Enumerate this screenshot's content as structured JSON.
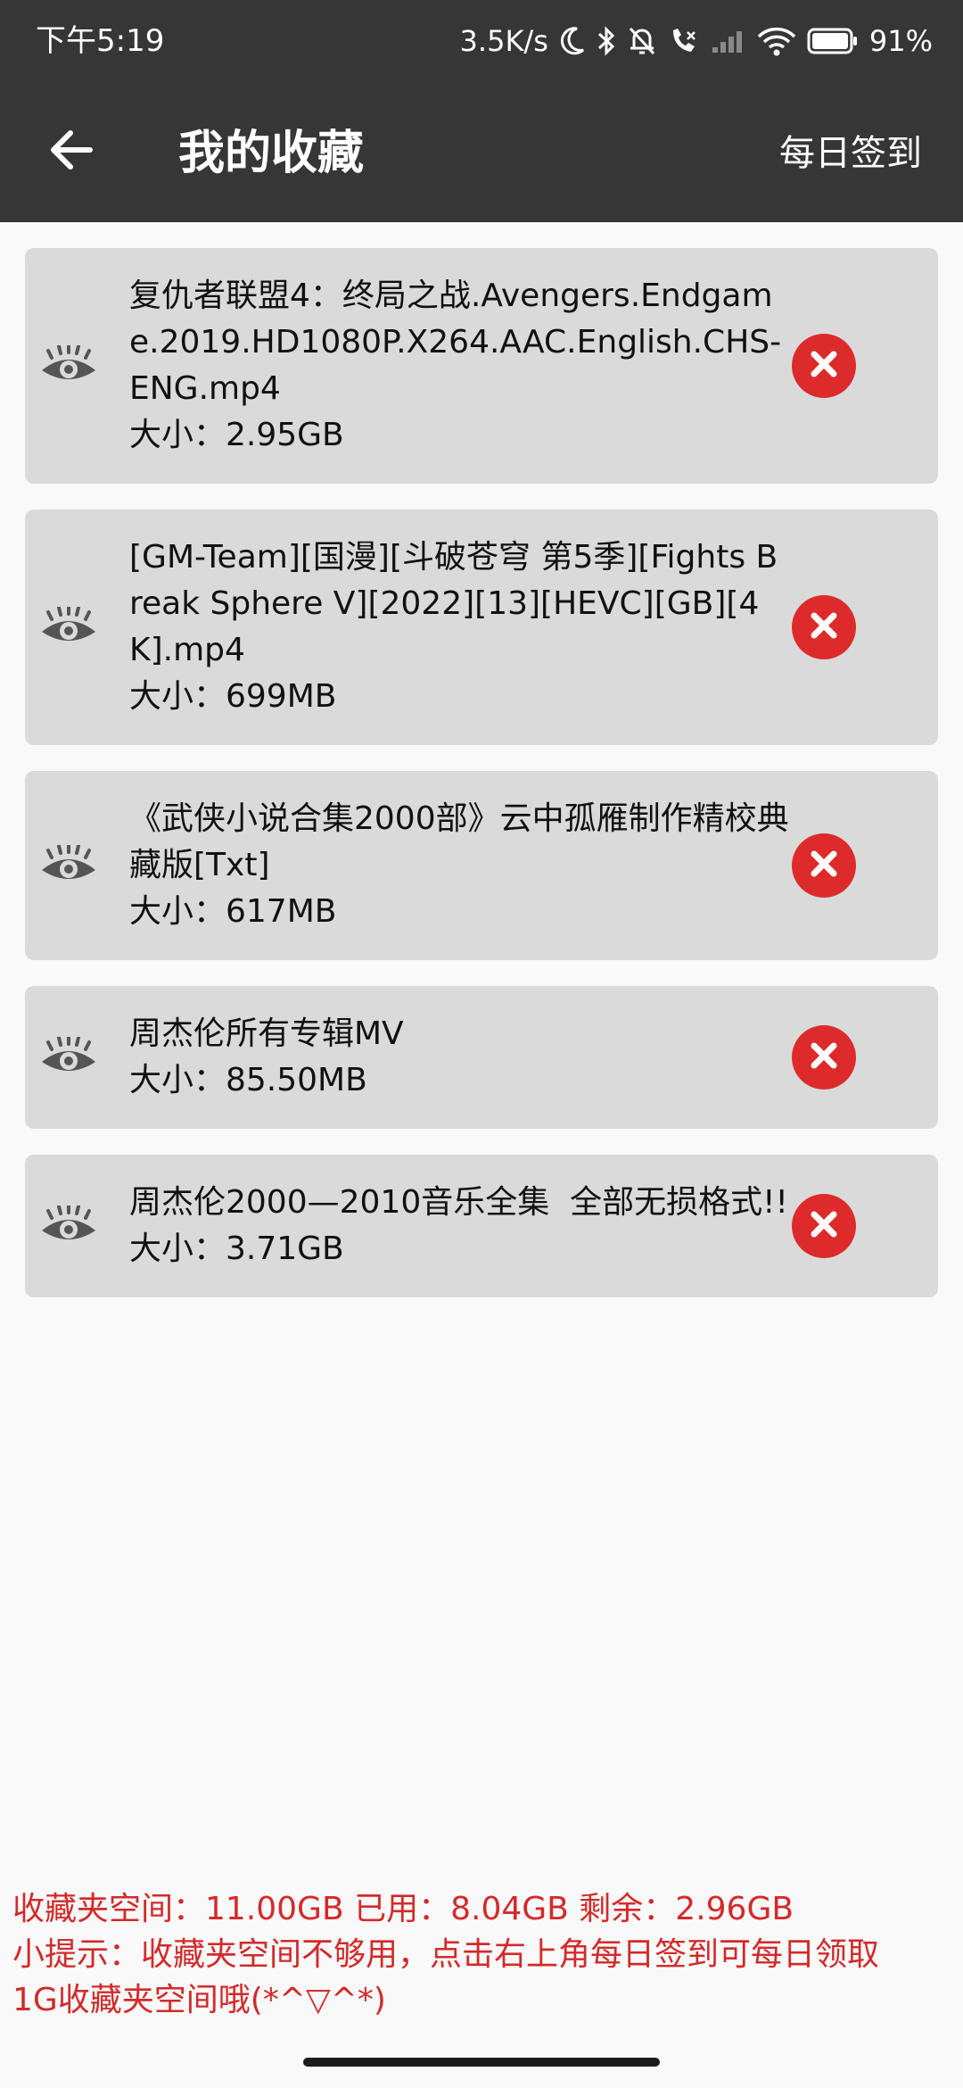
{
  "status_bar": {
    "time": "下午5:19",
    "net_speed": "3.5K/s",
    "battery": "91%",
    "icons": [
      "moon-icon",
      "bluetooth-icon",
      "bell-off-icon",
      "call-icon",
      "signal-icon",
      "wifi-icon",
      "battery-icon"
    ]
  },
  "app_bar": {
    "back_icon": "arrow-left-icon",
    "title": "我的收藏",
    "action_label": "每日签到"
  },
  "items": [
    {
      "name": "复仇者联盟4：终局之战.Avengers.Endgame.2019.HD1080P.X264.AAC.English.CHS-ENG.mp4",
      "size": "大小：2.95GB"
    },
    {
      "name": "[GM-Team][国漫][斗破苍穹 第5季][Fights Break Sphere Ⅴ][2022][13][HEVC][GB][4K].mp4",
      "size": "大小：699MB"
    },
    {
      "name": "《武侠小说合集2000部》云中孤雁制作精校典藏版[Txt]",
      "size": "大小：617MB"
    },
    {
      "name": "周杰伦所有专辑MV",
      "size": "大小：85.50MB"
    },
    {
      "name": "周杰伦2000—2010音乐全集  全部无损格式!!",
      "size": "大小：3.71GB"
    }
  ],
  "footer": {
    "space": "收藏夹空间：11.00GB 已用：8.04GB 剩余：2.96GB",
    "tip_line1": "小提示：收藏夹空间不够用，点击右上角每日签到可每日领取",
    "tip_line2": "1G收藏夹空间哦(*^▽^*)"
  },
  "colors": {
    "header_bg": "#363636",
    "card_bg": "#dadada",
    "delete_red": "#dd2b2b",
    "footer_red": "#d32a2a",
    "eye_gray": "#555555"
  }
}
